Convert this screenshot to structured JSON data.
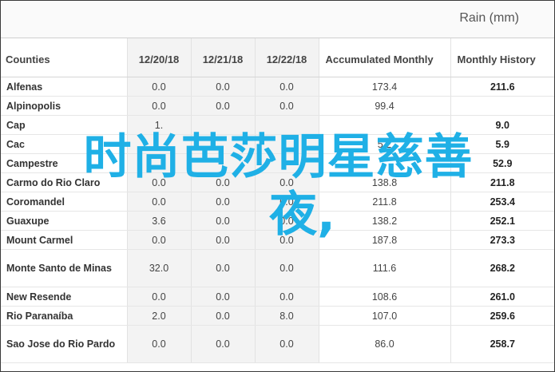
{
  "header": {
    "title": "Rain (mm)"
  },
  "columns": [
    "Counties",
    "12/20/18",
    "12/21/18",
    "12/22/18",
    "Accumulated Monthly",
    "Monthly History"
  ],
  "rows": [
    {
      "county": "Alfenas",
      "d1": "0.0",
      "d2": "0.0",
      "d3": "0.0",
      "acc": "173.4",
      "hist": "211.6"
    },
    {
      "county": "Alpinopolis",
      "d1": "0.0",
      "d2": "0.0",
      "d3": "0.0",
      "acc": "99.4",
      "hist": ""
    },
    {
      "county": "Cap",
      "d1": "1.",
      "d2": "",
      "d3": "",
      "acc": "",
      "hist": "9.0"
    },
    {
      "county": "Cac",
      "d1": "",
      "d2": "",
      "d3": "",
      "acc": "5.2",
      "hist": "5.9"
    },
    {
      "county": "Campestre",
      "d1": "",
      "d2": "",
      "d3": "",
      "acc": "",
      "hist": "52.9"
    },
    {
      "county": "Carmo do Rio Claro",
      "d1": "0.0",
      "d2": "0.0",
      "d3": "0.0",
      "acc": "138.8",
      "hist": "211.8"
    },
    {
      "county": "Coromandel",
      "d1": "0.0",
      "d2": "0.0",
      "d3": "0.0",
      "acc": "211.8",
      "hist": "253.4"
    },
    {
      "county": "Guaxupe",
      "d1": "3.6",
      "d2": "0.0",
      "d3": "0.0",
      "acc": "138.2",
      "hist": "252.1"
    },
    {
      "county": "Mount Carmel",
      "d1": "0.0",
      "d2": "0.0",
      "d3": "0.0",
      "acc": "187.8",
      "hist": "273.3"
    },
    {
      "county": "Monte Santo de Minas",
      "d1": "32.0",
      "d2": "0.0",
      "d3": "0.0",
      "acc": "111.6",
      "hist": "268.2"
    },
    {
      "county": "New Resende",
      "d1": "0.0",
      "d2": "0.0",
      "d3": "0.0",
      "acc": "108.6",
      "hist": "261.0"
    },
    {
      "county": "Rio Paranaíba",
      "d1": "2.0",
      "d2": "0.0",
      "d3": "8.0",
      "acc": "107.0",
      "hist": "259.6"
    },
    {
      "county": "Sao Jose do Rio Pardo",
      "d1": "0.0",
      "d2": "0.0",
      "d3": "0.0",
      "acc": "86.0",
      "hist": "258.7"
    }
  ],
  "overlay": {
    "line1": "时尚芭莎明星慈善",
    "line2": "夜,"
  },
  "colors": {
    "overlay": "#1fb0e6",
    "shade": "#f3f3f3"
  }
}
